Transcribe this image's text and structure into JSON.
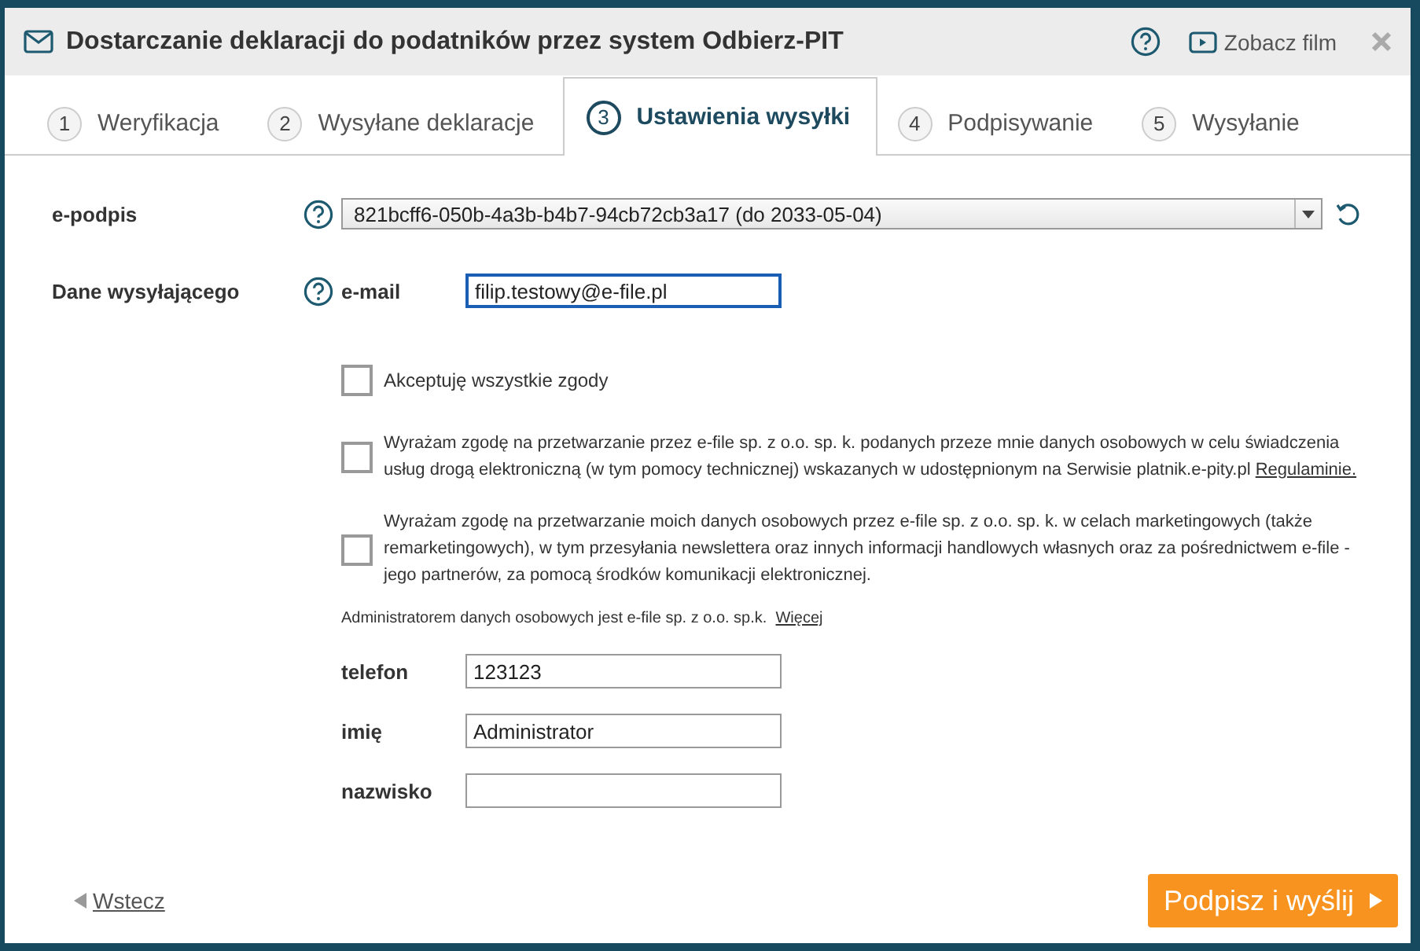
{
  "window": {
    "title": "Dostarczanie deklaracji do podatników przez system Odbierz-PIT",
    "video_link": "Zobacz film"
  },
  "tabs": [
    {
      "number": "1",
      "label": "Weryfikacja",
      "selected": false
    },
    {
      "number": "2",
      "label": "Wysyłane deklaracje",
      "selected": false
    },
    {
      "number": "3",
      "label": "Ustawienia wysyłki",
      "selected": true
    },
    {
      "number": "4",
      "label": "Podpisywanie",
      "selected": false
    },
    {
      "number": "5",
      "label": "Wysyłanie",
      "selected": false
    }
  ],
  "signature": {
    "label": "e-podpis",
    "value": "821bcff6-050b-4a3b-b4b7-94cb72cb3a17 (do 2033-05-04)"
  },
  "sender": {
    "label": "Dane wysyłającego",
    "email_label": "e-mail",
    "email": "filip.testowy@e-file.pl",
    "email_focused": true
  },
  "consents": [
    {
      "text": "Akceptuję wszystkie zgody",
      "checked": false
    },
    {
      "text": "Wyrażam zgodę na przetwarzanie przez e-file sp. z o.o. sp. k. podanych przeze mnie danych osobowych w celu świadczenia usług drogą elektroniczną (w tym pomocy technicznej) wskazanych w udostępnionym na Serwisie platnik.e-pity.pl",
      "link": "Regulaminie.",
      "checked": false
    },
    {
      "text": "Wyrażam zgodę na przetwarzanie moich danych osobowych przez e-file sp. z o.o. sp. k. w celach marketingowych (także remarketingowych), w tym przesyłania newslettera oraz innych informacji handlowych własnych oraz za pośrednictwem e-file - jego partnerów, za pomocą środków komunikacji elektronicznej.",
      "checked": false
    }
  ],
  "admin_note": {
    "text": "Administratorem danych osobowych jest e-file sp. z o.o. sp.k.",
    "link": "Więcej"
  },
  "fields": [
    {
      "label": "telefon",
      "value": "123123"
    },
    {
      "label": "imię",
      "value": "Administrator"
    },
    {
      "label": "nazwisko"
    }
  ],
  "back_link": "Wstecz",
  "submit_button": "Podpisz i wyślij"
}
